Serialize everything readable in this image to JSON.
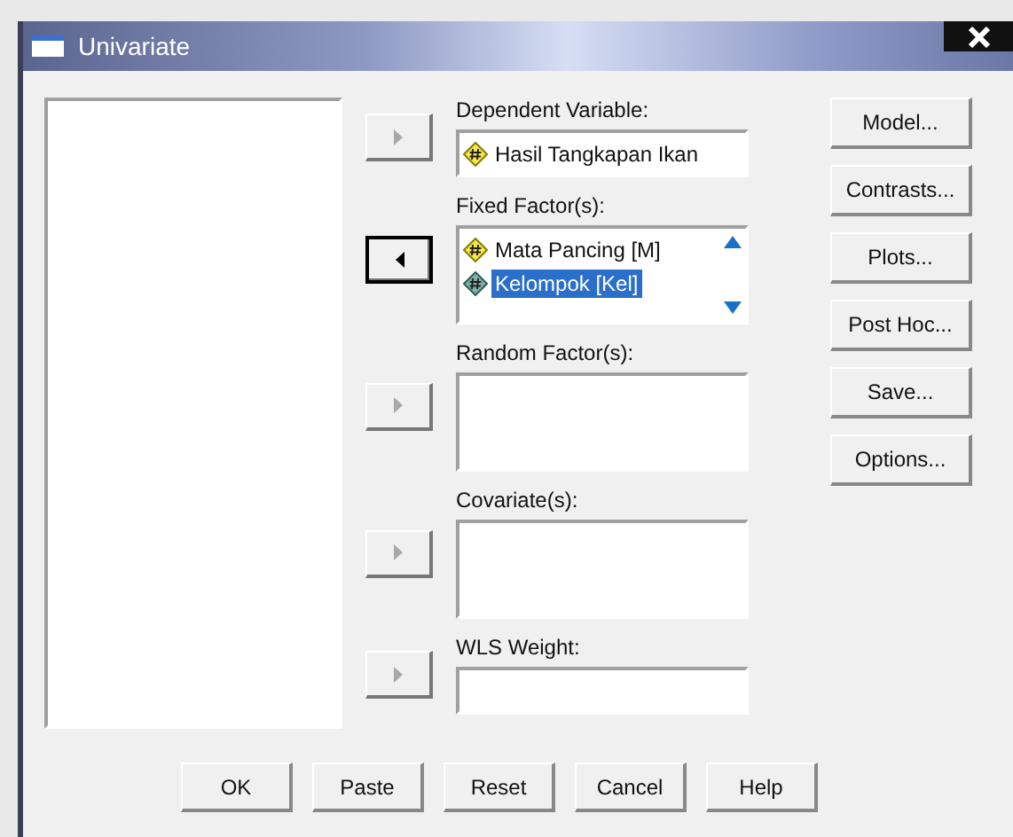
{
  "window": {
    "title": "Univariate"
  },
  "targets": [
    {
      "label": "Dependent Variable:",
      "kind": "field",
      "arrow": {
        "kind": "right",
        "disabled": true
      },
      "items": [
        {
          "name": "Hasil Tangkapan Ikan",
          "kind": "scale",
          "selected": false
        }
      ]
    },
    {
      "label": "Fixed Factor(s):",
      "kind": "list",
      "arrow": {
        "kind": "left",
        "disabled": false
      },
      "items": [
        {
          "name": "Mata Pancing [M]",
          "kind": "scale",
          "selected": false
        },
        {
          "name": "Kelompok [Kel]",
          "kind": "nominal",
          "selected": true
        }
      ]
    },
    {
      "label": "Random Factor(s):",
      "kind": "list",
      "arrow": {
        "kind": "right",
        "disabled": true
      }
    },
    {
      "label": "Covariate(s):",
      "kind": "list",
      "arrow": {
        "kind": "right",
        "disabled": true
      }
    },
    {
      "label": "WLS Weight:",
      "kind": "field",
      "arrow": {
        "kind": "right",
        "disabled": true
      }
    }
  ],
  "side_buttons": [
    "Model...",
    "Contrasts...",
    "Plots...",
    "Post Hoc...",
    "Save...",
    "Options..."
  ],
  "bottom_buttons": [
    "OK",
    "Paste",
    "Reset",
    "Cancel",
    "Help"
  ]
}
